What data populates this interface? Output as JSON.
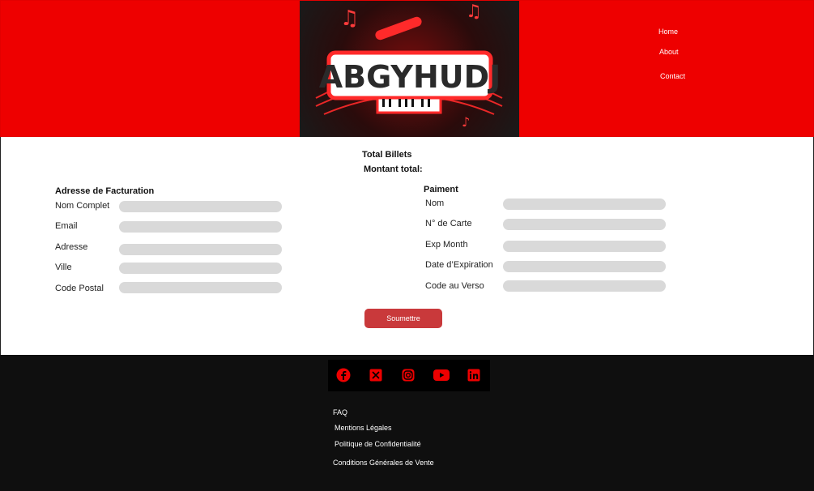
{
  "header": {
    "logo_text": "ABGYHUDJ",
    "nav": [
      "Home",
      "About",
      "Contact"
    ],
    "colors": {
      "background": "#ee0000",
      "logo_bg": "#1a1a1a"
    }
  },
  "summary": {
    "total_billets_label": "Total Billets",
    "montant_total_label": "Montant total:"
  },
  "billing": {
    "title": "Adresse de Facturation",
    "fields": [
      {
        "label": "Nom Complet",
        "value": ""
      },
      {
        "label": "Email",
        "value": ""
      },
      {
        "label": "Adresse",
        "value": ""
      },
      {
        "label": "Ville",
        "value": ""
      },
      {
        "label": "Code Postal",
        "value": ""
      }
    ]
  },
  "payment": {
    "title": "Paiment",
    "fields": [
      {
        "label": "Nom",
        "value": ""
      },
      {
        "label": "N° de Carte",
        "value": ""
      },
      {
        "label": "Exp Month",
        "value": ""
      },
      {
        "label": "Date d’Expiration",
        "value": ""
      },
      {
        "label": "Code au Verso",
        "value": ""
      }
    ]
  },
  "submit_label": "Soumettre",
  "footer": {
    "social_icons": [
      "facebook-icon",
      "x-icon",
      "instagram-icon",
      "youtube-icon",
      "linkedin-icon"
    ],
    "links": [
      "FAQ",
      "Mentions Légales",
      "Politique de Confidentialité",
      "Conditions Générales de Vente"
    ],
    "colors": {
      "background": "#0f0f0f",
      "icon": "#ee0000"
    }
  }
}
